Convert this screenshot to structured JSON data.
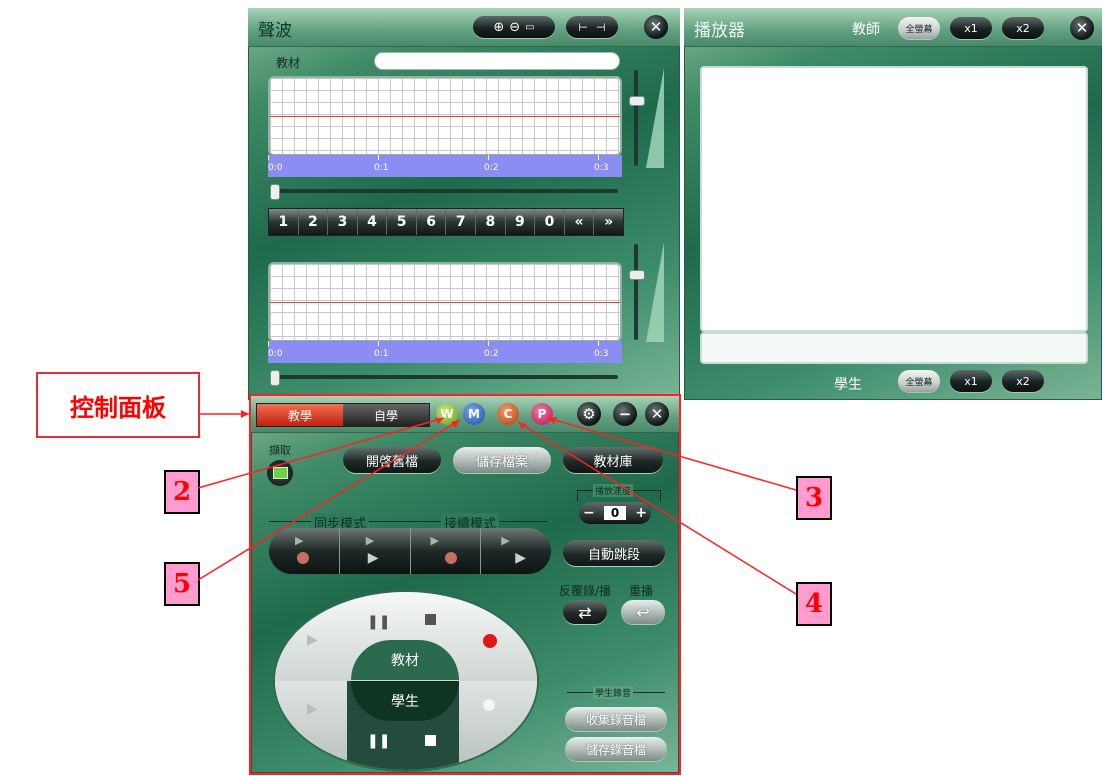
{
  "waveform_panel": {
    "title": "聲波",
    "textbook_label": "教材",
    "ruler_ticks": [
      "0:0",
      "0:1",
      "0:2",
      "0:3"
    ],
    "num_keys": [
      "1",
      "2",
      "3",
      "4",
      "5",
      "6",
      "7",
      "8",
      "9",
      "0",
      "«",
      "»"
    ]
  },
  "player_panel": {
    "title": "播放器",
    "teacher_label": "教師",
    "student_label": "學生",
    "fullscreen_label": "全螢幕",
    "x1_label": "x1",
    "x2_label": "x2"
  },
  "control_panel": {
    "tab_teach": "教學",
    "tab_self": "自學",
    "mode_buttons": [
      "W",
      "M",
      "C",
      "P"
    ],
    "capture_label": "擷取",
    "open_file_label": "開啓舊檔",
    "save_file_label": "儲存檔案",
    "library_label": "教材庫",
    "speed_label": "播放速度",
    "speed_value": "0",
    "sync_mode_label": "同步模式",
    "continue_mode_label": "接續模式",
    "auto_jump_label": "自動跳段",
    "repeat_label": "反覆錄/播",
    "replay_label": "重播",
    "textbook_label": "教材",
    "student_label": "學生",
    "student_recording_label": "學生錄音",
    "collect_recordings_label": "收集錄音檔",
    "save_recordings_label": "儲存錄音檔"
  },
  "annotations": {
    "control_panel_label": "控制面板",
    "callouts": [
      "2",
      "3",
      "4",
      "5"
    ]
  },
  "colors": {
    "callout_red": "#ff0000",
    "callout_fill": "#ff9ccf",
    "ruler_blue": "#8b8df2",
    "tab_active": "#d83018",
    "btn_w": "#8cbf2a",
    "btn_m": "#2e64b8",
    "btn_c": "#d8501f",
    "btn_p": "#d8186a"
  }
}
